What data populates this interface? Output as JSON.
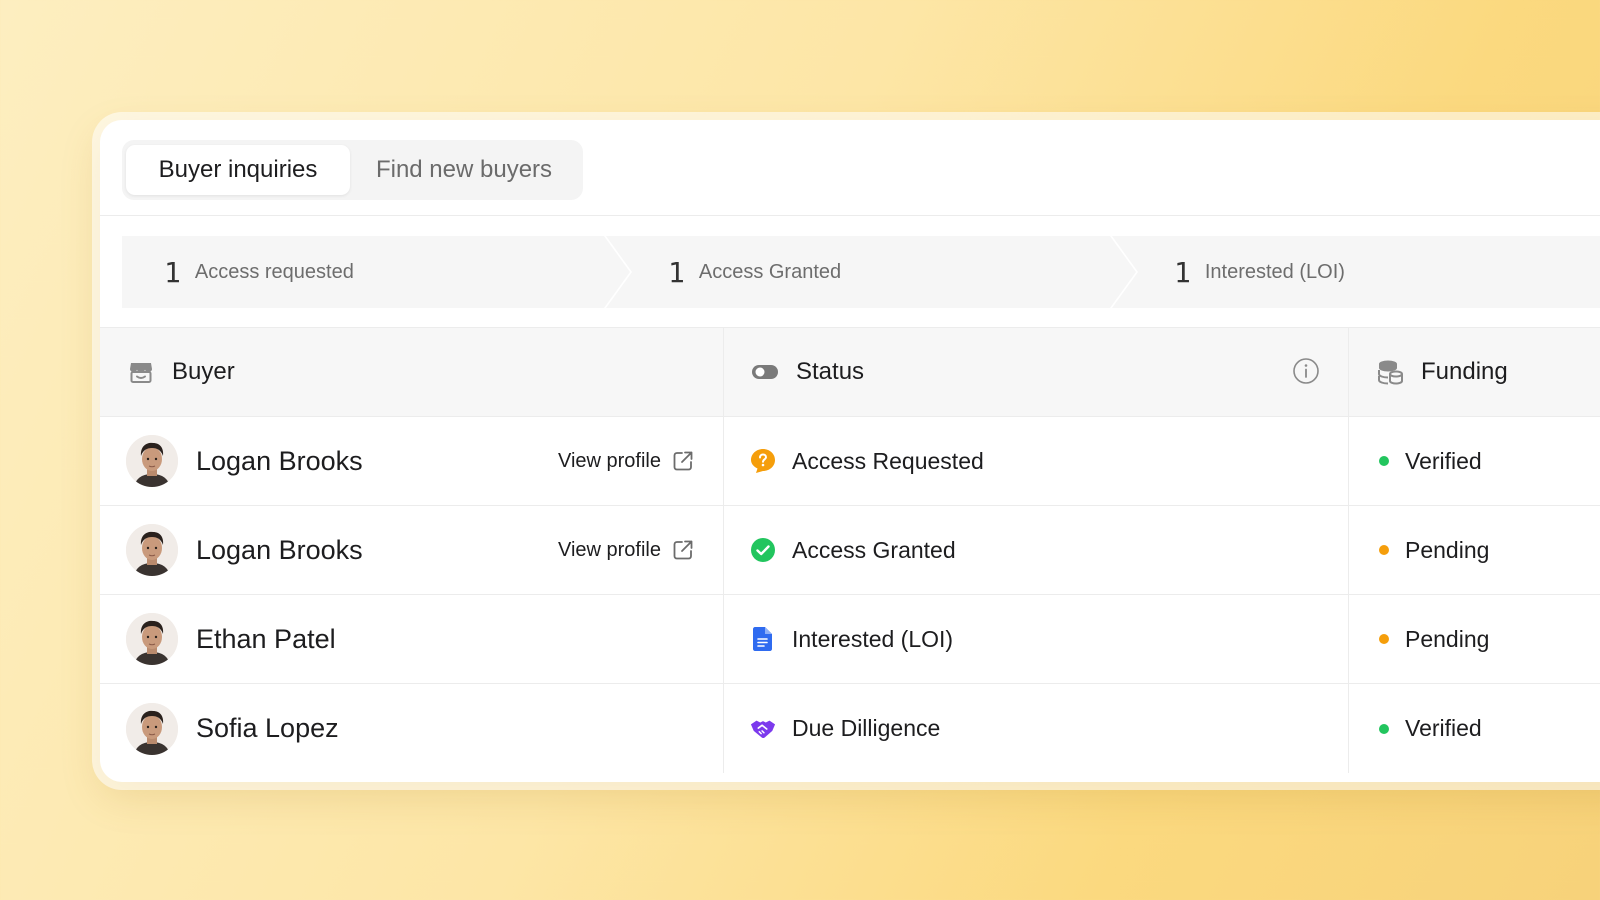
{
  "tabs": [
    {
      "label": "Buyer inquiries",
      "active": true
    },
    {
      "label": "Find new buyers",
      "active": false
    }
  ],
  "pipeline": [
    {
      "count": "1",
      "label": "Access requested"
    },
    {
      "count": "1",
      "label": "Access Granted"
    },
    {
      "count": "1",
      "label": "Interested (LOI)"
    }
  ],
  "columns": {
    "buyer": {
      "label": "Buyer",
      "icon": "store-icon"
    },
    "status": {
      "label": "Status",
      "icon": "toggle-icon"
    },
    "funding": {
      "label": "Funding",
      "icon": "coins-icon"
    }
  },
  "rows": [
    {
      "name": "Logan Brooks",
      "view_profile": "View profile",
      "status": "Access Requested",
      "status_icon": "question-icon",
      "funding": "Verified"
    },
    {
      "name": "Logan Brooks",
      "view_profile": "View profile",
      "status": "Access Granted",
      "status_icon": "check-circle-icon",
      "funding": "Pending"
    },
    {
      "name": "Ethan Patel",
      "view_profile": "",
      "status": "Interested (LOI)",
      "status_icon": "document-icon",
      "funding": "Pending"
    },
    {
      "name": "Sofia Lopez",
      "view_profile": "",
      "status": "Due Dilligence",
      "status_icon": "handshake-icon",
      "funding": "Verified"
    }
  ],
  "colors": {
    "verified": "#22c55e",
    "pending": "#f59e0b",
    "question": "#f59e0b",
    "check": "#22c55e",
    "document": "#2f6bf0",
    "handshake": "#7c3aed"
  }
}
